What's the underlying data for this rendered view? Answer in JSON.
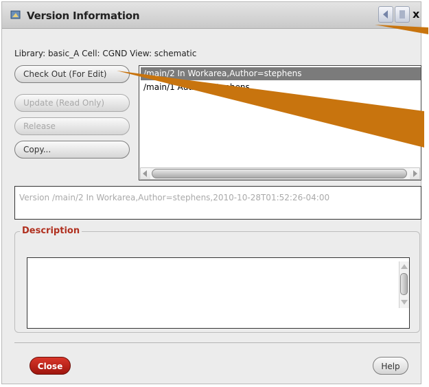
{
  "window": {
    "title": "Version Information",
    "close_glyph": "x",
    "icons": [
      "app-icon",
      "minimize-icon",
      "maximize-icon",
      "close-icon"
    ]
  },
  "info_line": "Library: basic_A  Cell: CGND  View: schematic",
  "buttons": {
    "check_out": "Check Out (For Edit)",
    "update": "Update (Read Only)",
    "release": "Release",
    "copy": "Copy..."
  },
  "version_list": [
    {
      "text": "/main/2 In Workarea,Author=stephens",
      "selected": true
    },
    {
      "text": "/main/1 Author=stephens",
      "selected": false
    }
  ],
  "version_field": "Version /main/2 In Workarea,Author=stephens,2010-10-28T01:52:26-04:00",
  "description": {
    "label": "Description",
    "text": ""
  },
  "footer": {
    "close": "Close",
    "help": "Help"
  },
  "colors": {
    "close_button": "#c0241a",
    "description_label": "#b0301f",
    "annotation_arrow": "#c8740e",
    "selection": "#7b7b7b"
  }
}
